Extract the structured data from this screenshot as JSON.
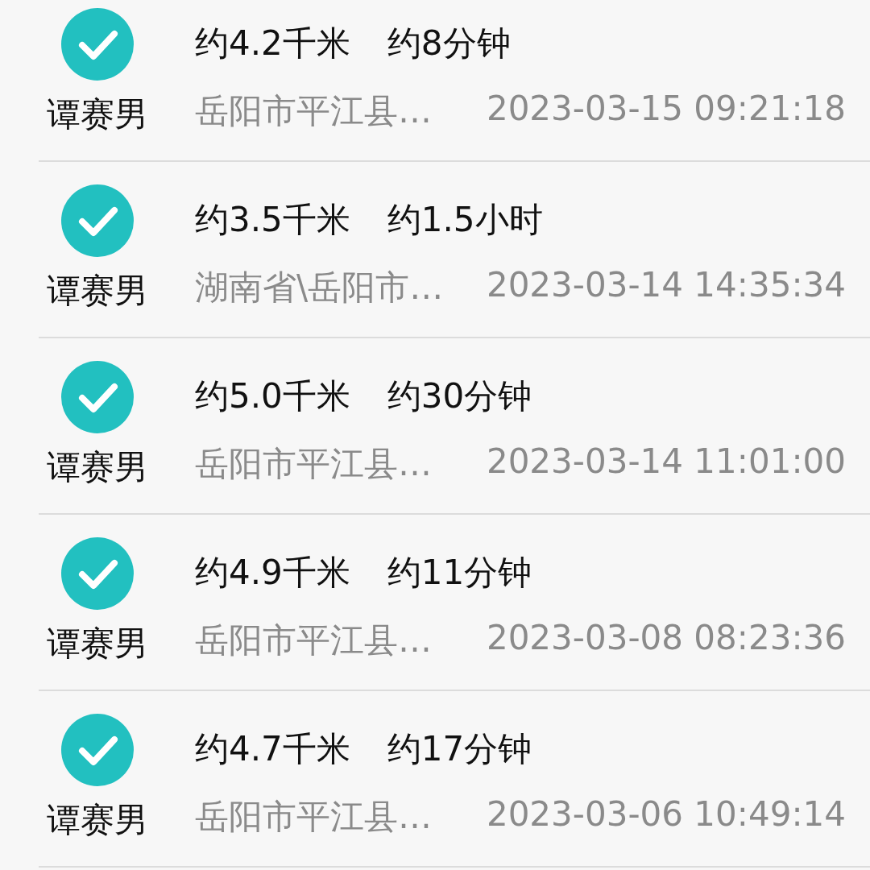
{
  "records": [
    {
      "checked": true,
      "name": "谭赛男",
      "distance": "约4.2千米",
      "duration": "约8分钟",
      "address": "岳阳市平江县…",
      "time": "2023-03-15 09:21:18"
    },
    {
      "checked": true,
      "name": "谭赛男",
      "distance": "约3.5千米",
      "duration": "约1.5小时",
      "address": "湖南省\\岳阳市…",
      "time": "2023-03-14 14:35:34"
    },
    {
      "checked": true,
      "name": "谭赛男",
      "distance": "约5.0千米",
      "duration": "约30分钟",
      "address": "岳阳市平江县…",
      "time": "2023-03-14 11:01:00"
    },
    {
      "checked": true,
      "name": "谭赛男",
      "distance": "约4.9千米",
      "duration": "约11分钟",
      "address": "岳阳市平江县…",
      "time": "2023-03-08 08:23:36"
    },
    {
      "checked": true,
      "name": "谭赛男",
      "distance": "约4.7千米",
      "duration": "约17分钟",
      "address": "岳阳市平江县…",
      "time": "2023-03-06 10:49:14"
    }
  ]
}
